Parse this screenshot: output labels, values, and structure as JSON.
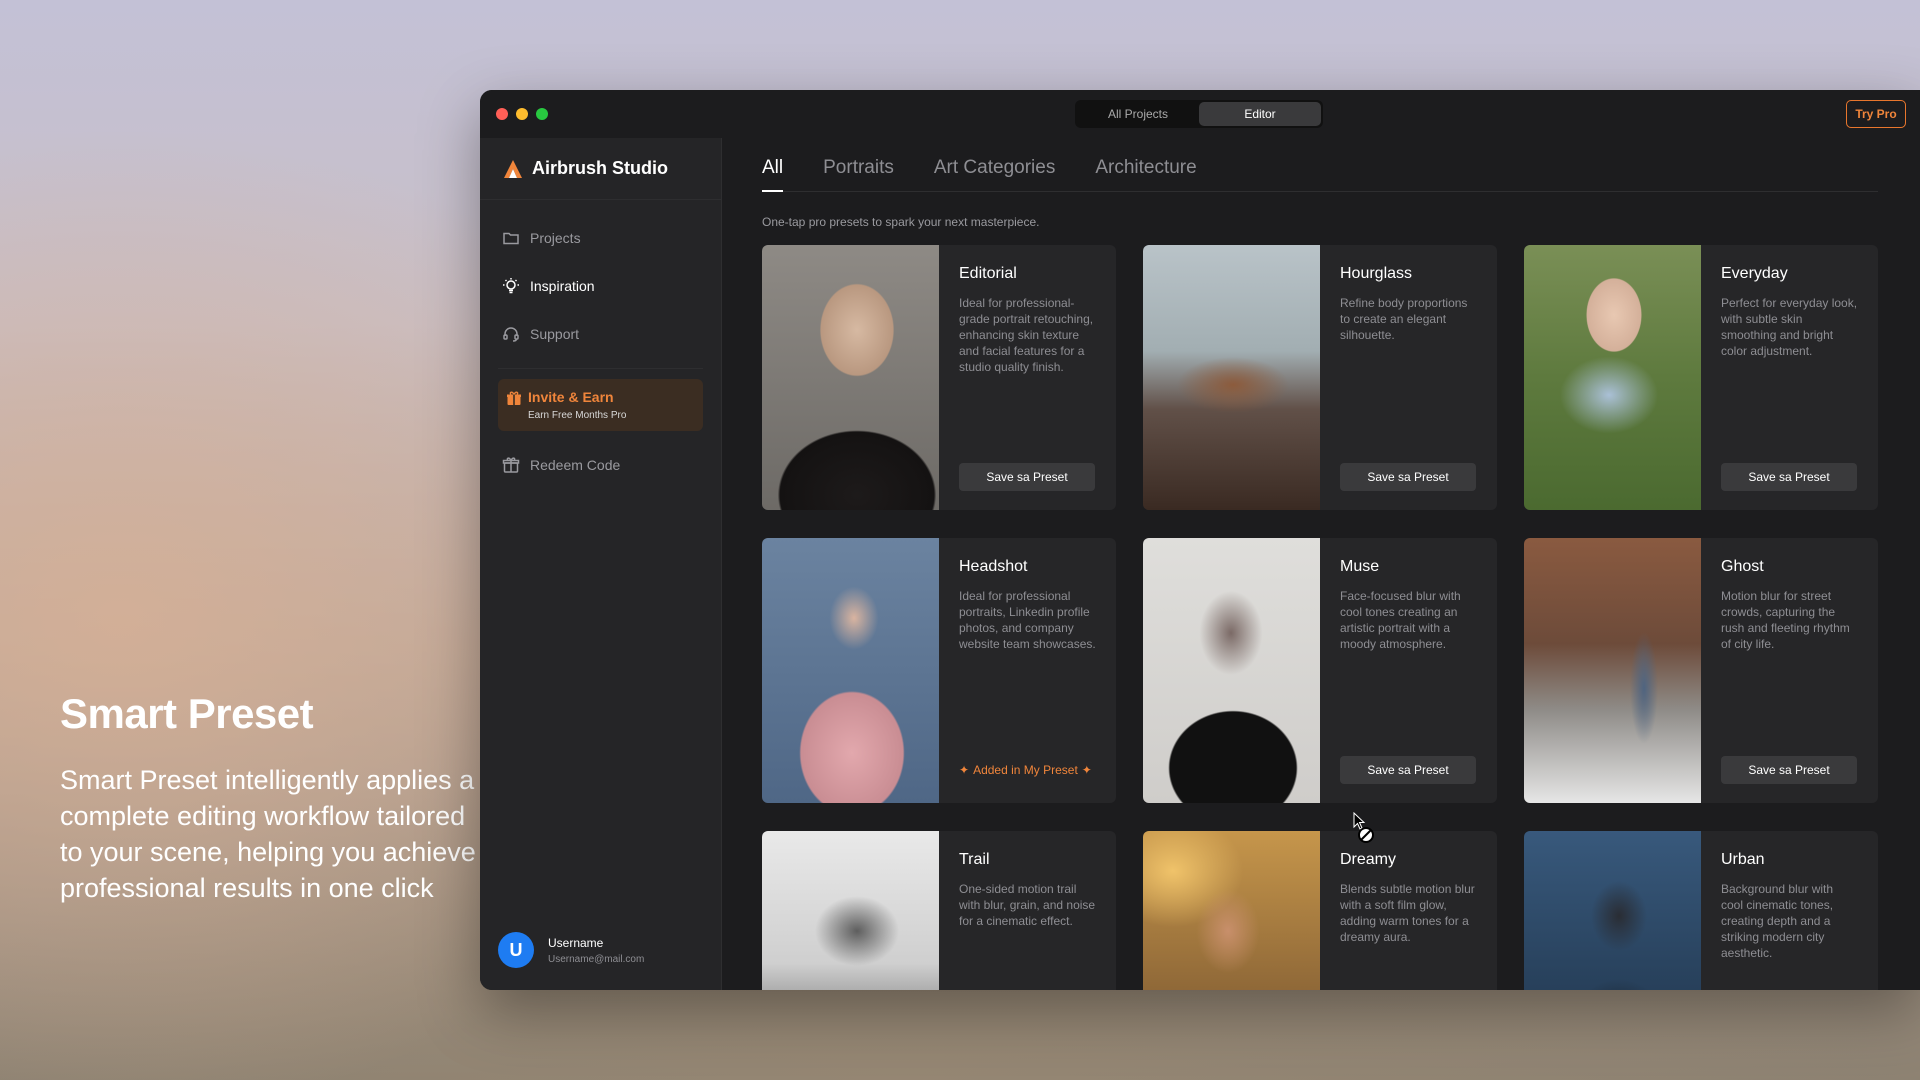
{
  "promo": {
    "title": "Smart Preset",
    "text": "Smart Preset intelligently applies a complete editing workflow tailored to your scene, helping you achieve professional results in one click"
  },
  "window": {
    "segments": [
      "All Projects",
      "Editor"
    ],
    "active_segment": "Editor",
    "try_pro": "Try Pro"
  },
  "sidebar": {
    "brand": "Airbrush Studio",
    "items": [
      {
        "label": "Projects",
        "icon": "folder-icon"
      },
      {
        "label": "Inspiration",
        "icon": "lightbulb-icon",
        "active": true
      },
      {
        "label": "Support",
        "icon": "headset-icon"
      }
    ],
    "invite": {
      "title": "Invite & Earn",
      "subtitle": "Earn Free Months Pro",
      "icon": "gift-icon"
    },
    "redeem": {
      "label": "Redeem Code",
      "icon": "gift-box-icon"
    },
    "user": {
      "initial": "U",
      "name": "Username",
      "email": "Username@mail.com"
    }
  },
  "main": {
    "tabs": [
      "All",
      "Portraits",
      "Art Categories",
      "Architecture"
    ],
    "active_tab": "All",
    "subtitle": "One-tap pro presets to spark your next masterpiece.",
    "save_label": "Save sa Preset",
    "added_label": "Added in My Preset",
    "presets": [
      {
        "title": "Editorial",
        "desc": "Ideal for professional-grade portrait retouching, enhancing skin texture and facial features for a studio quality finish."
      },
      {
        "title": "Hourglass",
        "desc": "Refine body proportions to create an elegant silhouette."
      },
      {
        "title": "Everyday",
        "desc": "Perfect for everyday look, with subtle skin smoothing and bright color adjustment."
      },
      {
        "title": "Headshot",
        "desc": "Ideal for professional portraits, Linkedin profile photos, and company website team showcases.",
        "added": true
      },
      {
        "title": "Muse",
        "desc": "Face-focused blur with cool tones creating an artistic portrait with a moody atmosphere."
      },
      {
        "title": "Ghost",
        "desc": "Motion blur for street crowds, capturing the rush and fleeting rhythm of city life."
      },
      {
        "title": "Trail",
        "desc": "One-sided motion trail with blur, grain, and noise for a cinematic effect."
      },
      {
        "title": "Dreamy",
        "desc": "Blends subtle motion blur with a soft film glow, adding warm tones for a dreamy aura."
      },
      {
        "title": "Urban",
        "desc": "Background blur with cool cinematic tones, creating depth and a striking modern city aesthetic."
      }
    ]
  },
  "colors": {
    "accent": "#f0853b",
    "avatar": "#1e7cf2",
    "window_bg": "#1c1c1e"
  }
}
